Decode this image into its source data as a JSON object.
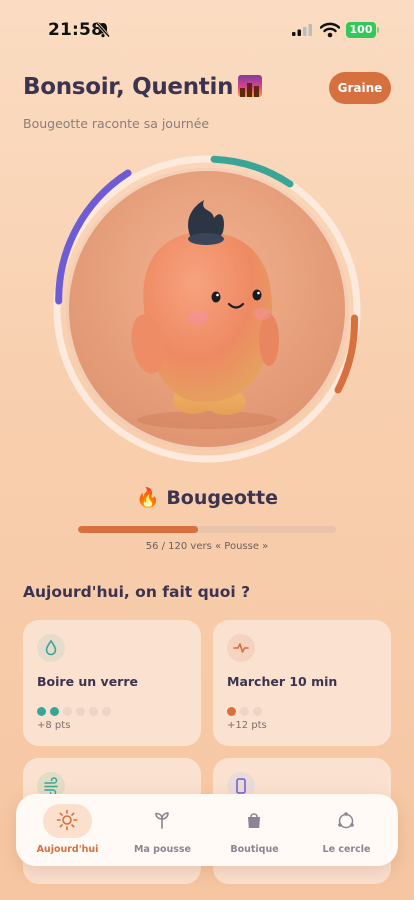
{
  "status": {
    "time": "21:58",
    "battery": "100"
  },
  "header": {
    "greeting": "Bonsoir, Quentin",
    "stage_badge": "Graine",
    "subtitle": "Bougeotte raconte sa journée"
  },
  "pet": {
    "emoji": "🔥",
    "name": "Bougeotte",
    "progress": {
      "current": 56,
      "max": 120,
      "fraction": 0.467,
      "label": "56 / 120 vers « Pousse »"
    }
  },
  "ring_segments": [
    {
      "name": "left-segment",
      "color": "#6e5bd6"
    },
    {
      "name": "top-segment",
      "color": "#3aa597"
    },
    {
      "name": "right-segment",
      "color": "#d7703f"
    }
  ],
  "today": {
    "title": "Aujourd'hui, on fait quoi ?",
    "cards": [
      {
        "title": "Boire un verre",
        "points": "+8 pts",
        "icon": "water-drop-icon",
        "accent": "#3aa597",
        "dots_total": 6,
        "dots_done": 2
      },
      {
        "title": "Marcher 10 min",
        "points": "+12 pts",
        "icon": "heartbeat-icon",
        "accent": "#d7703f",
        "dots_total": 3,
        "dots_done": 1
      }
    ]
  },
  "tabs": [
    {
      "label": "Aujourd'hui",
      "icon": "sun-icon",
      "active": true
    },
    {
      "label": "Ma pousse",
      "icon": "sprout-icon",
      "active": false
    },
    {
      "label": "Boutique",
      "icon": "shopping-bag-icon",
      "active": false
    },
    {
      "label": "Le cercle",
      "icon": "circle-nodes-icon",
      "active": false
    }
  ],
  "colors": {
    "accent": "#d7703f",
    "teal": "#3aa597",
    "purple": "#6e5bd6",
    "ink": "#3b3350"
  }
}
